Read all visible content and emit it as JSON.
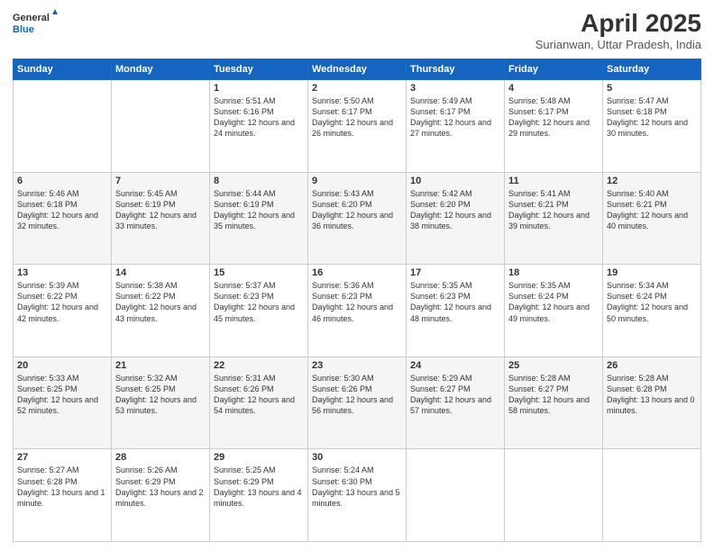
{
  "logo": {
    "general": "General",
    "blue": "Blue"
  },
  "header": {
    "month": "April 2025",
    "location": "Surianwan, Uttar Pradesh, India"
  },
  "weekdays": [
    "Sunday",
    "Monday",
    "Tuesday",
    "Wednesday",
    "Thursday",
    "Friday",
    "Saturday"
  ],
  "weeks": [
    [
      {
        "day": "",
        "info": ""
      },
      {
        "day": "",
        "info": ""
      },
      {
        "day": "1",
        "info": "Sunrise: 5:51 AM\nSunset: 6:16 PM\nDaylight: 12 hours and 24 minutes."
      },
      {
        "day": "2",
        "info": "Sunrise: 5:50 AM\nSunset: 6:17 PM\nDaylight: 12 hours and 26 minutes."
      },
      {
        "day": "3",
        "info": "Sunrise: 5:49 AM\nSunset: 6:17 PM\nDaylight: 12 hours and 27 minutes."
      },
      {
        "day": "4",
        "info": "Sunrise: 5:48 AM\nSunset: 6:17 PM\nDaylight: 12 hours and 29 minutes."
      },
      {
        "day": "5",
        "info": "Sunrise: 5:47 AM\nSunset: 6:18 PM\nDaylight: 12 hours and 30 minutes."
      }
    ],
    [
      {
        "day": "6",
        "info": "Sunrise: 5:46 AM\nSunset: 6:18 PM\nDaylight: 12 hours and 32 minutes."
      },
      {
        "day": "7",
        "info": "Sunrise: 5:45 AM\nSunset: 6:19 PM\nDaylight: 12 hours and 33 minutes."
      },
      {
        "day": "8",
        "info": "Sunrise: 5:44 AM\nSunset: 6:19 PM\nDaylight: 12 hours and 35 minutes."
      },
      {
        "day": "9",
        "info": "Sunrise: 5:43 AM\nSunset: 6:20 PM\nDaylight: 12 hours and 36 minutes."
      },
      {
        "day": "10",
        "info": "Sunrise: 5:42 AM\nSunset: 6:20 PM\nDaylight: 12 hours and 38 minutes."
      },
      {
        "day": "11",
        "info": "Sunrise: 5:41 AM\nSunset: 6:21 PM\nDaylight: 12 hours and 39 minutes."
      },
      {
        "day": "12",
        "info": "Sunrise: 5:40 AM\nSunset: 6:21 PM\nDaylight: 12 hours and 40 minutes."
      }
    ],
    [
      {
        "day": "13",
        "info": "Sunrise: 5:39 AM\nSunset: 6:22 PM\nDaylight: 12 hours and 42 minutes."
      },
      {
        "day": "14",
        "info": "Sunrise: 5:38 AM\nSunset: 6:22 PM\nDaylight: 12 hours and 43 minutes."
      },
      {
        "day": "15",
        "info": "Sunrise: 5:37 AM\nSunset: 6:23 PM\nDaylight: 12 hours and 45 minutes."
      },
      {
        "day": "16",
        "info": "Sunrise: 5:36 AM\nSunset: 6:23 PM\nDaylight: 12 hours and 46 minutes."
      },
      {
        "day": "17",
        "info": "Sunrise: 5:35 AM\nSunset: 6:23 PM\nDaylight: 12 hours and 48 minutes."
      },
      {
        "day": "18",
        "info": "Sunrise: 5:35 AM\nSunset: 6:24 PM\nDaylight: 12 hours and 49 minutes."
      },
      {
        "day": "19",
        "info": "Sunrise: 5:34 AM\nSunset: 6:24 PM\nDaylight: 12 hours and 50 minutes."
      }
    ],
    [
      {
        "day": "20",
        "info": "Sunrise: 5:33 AM\nSunset: 6:25 PM\nDaylight: 12 hours and 52 minutes."
      },
      {
        "day": "21",
        "info": "Sunrise: 5:32 AM\nSunset: 6:25 PM\nDaylight: 12 hours and 53 minutes."
      },
      {
        "day": "22",
        "info": "Sunrise: 5:31 AM\nSunset: 6:26 PM\nDaylight: 12 hours and 54 minutes."
      },
      {
        "day": "23",
        "info": "Sunrise: 5:30 AM\nSunset: 6:26 PM\nDaylight: 12 hours and 56 minutes."
      },
      {
        "day": "24",
        "info": "Sunrise: 5:29 AM\nSunset: 6:27 PM\nDaylight: 12 hours and 57 minutes."
      },
      {
        "day": "25",
        "info": "Sunrise: 5:28 AM\nSunset: 6:27 PM\nDaylight: 12 hours and 58 minutes."
      },
      {
        "day": "26",
        "info": "Sunrise: 5:28 AM\nSunset: 6:28 PM\nDaylight: 13 hours and 0 minutes."
      }
    ],
    [
      {
        "day": "27",
        "info": "Sunrise: 5:27 AM\nSunset: 6:28 PM\nDaylight: 13 hours and 1 minute."
      },
      {
        "day": "28",
        "info": "Sunrise: 5:26 AM\nSunset: 6:29 PM\nDaylight: 13 hours and 2 minutes."
      },
      {
        "day": "29",
        "info": "Sunrise: 5:25 AM\nSunset: 6:29 PM\nDaylight: 13 hours and 4 minutes."
      },
      {
        "day": "30",
        "info": "Sunrise: 5:24 AM\nSunset: 6:30 PM\nDaylight: 13 hours and 5 minutes."
      },
      {
        "day": "",
        "info": ""
      },
      {
        "day": "",
        "info": ""
      },
      {
        "day": "",
        "info": ""
      }
    ]
  ]
}
